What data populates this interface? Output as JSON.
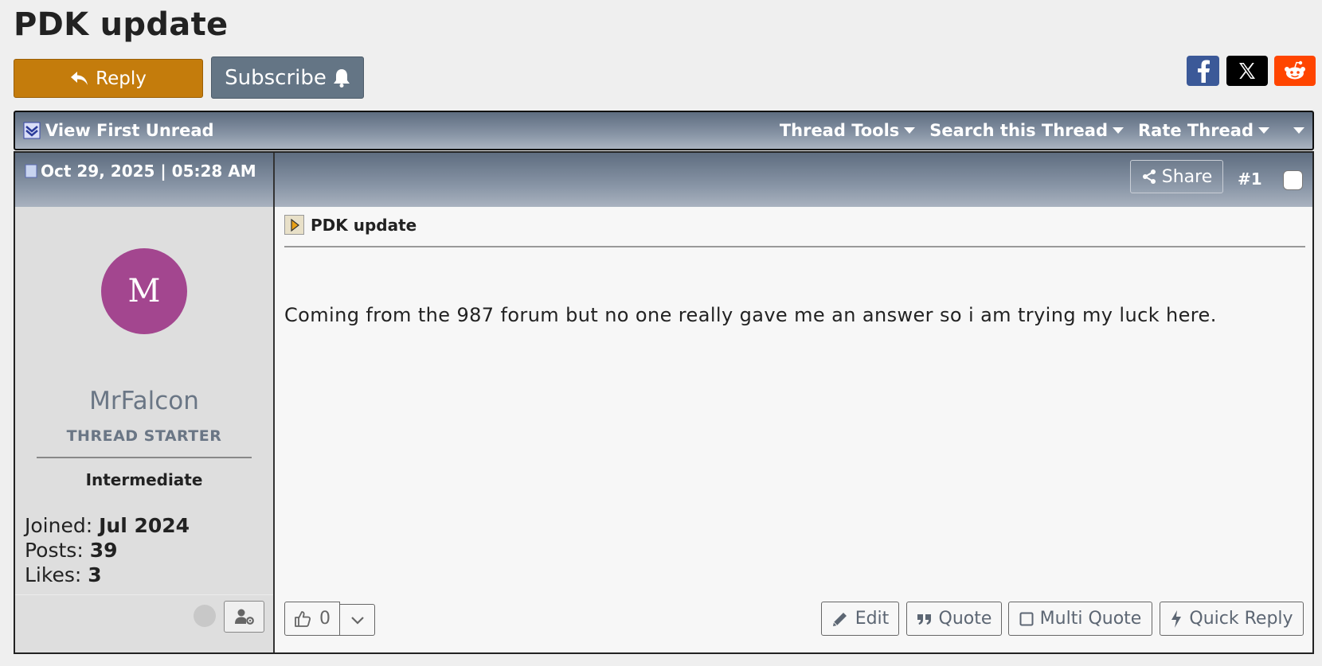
{
  "page": {
    "title": "PDK update"
  },
  "actions": {
    "reply_label": "Reply",
    "subscribe_label": "Subscribe"
  },
  "social": {
    "icons": [
      "facebook-icon",
      "x-icon",
      "reddit-icon"
    ],
    "colors": {
      "facebook": "#3b5998",
      "x": "#000000",
      "reddit": "#ff4500"
    }
  },
  "toolbar": {
    "first_unread_label": "View First Unread",
    "menus": [
      "Thread Tools",
      "Search this Thread",
      "Rate Thread"
    ]
  },
  "post": {
    "date": "Oct 29, 2025 | 05:28 AM",
    "share_label": "Share",
    "number": "#1",
    "title": "PDK update",
    "body": "Coming from the 987 forum but no one really gave me an answer so i am trying my luck here.",
    "likes_count": "0",
    "buttons": {
      "edit": "Edit",
      "quote": "Quote",
      "multi_quote": "Multi Quote",
      "quick_reply": "Quick Reply"
    }
  },
  "user": {
    "avatar_letter": "M",
    "avatar_color": "#a3468f",
    "name": "MrFalcon",
    "badge": "THREAD STARTER",
    "rank": "Intermediate",
    "joined_label": "Joined:",
    "joined": "Jul 2024",
    "posts_label": "Posts:",
    "posts": "39",
    "likes_label": "Likes:",
    "likes": "3"
  },
  "colors": {
    "reply_button": "#c47c0c",
    "subscribe_button": "#647585",
    "header_bar": "#6e7c8e"
  }
}
